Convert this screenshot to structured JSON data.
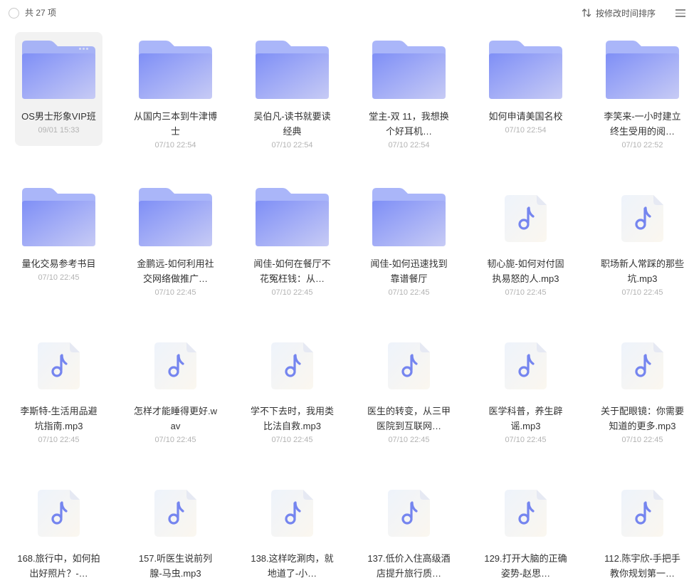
{
  "toolbar": {
    "count_label": "共 27 项",
    "sort_label": "按修改时间排序"
  },
  "colors": {
    "folder_back": "#8e9df7",
    "folder_front_start": "#7f8ff6",
    "folder_front_end": "#c7cbf5",
    "note_icon": "#7585ef",
    "selected_bg": "#f2f2f2"
  },
  "items": [
    {
      "type": "folder",
      "name": "OS男士形象VIP班",
      "date": "09/01 15:33",
      "selected": true
    },
    {
      "type": "folder",
      "name": "从国内三本到牛津博士",
      "date": "07/10 22:54"
    },
    {
      "type": "folder",
      "name": "吴伯凡-读书就要读经典",
      "date": "07/10 22:54"
    },
    {
      "type": "folder",
      "name": "堂主-双 11，我想换个好耳机…",
      "date": "07/10 22:54"
    },
    {
      "type": "folder",
      "name": "如何申请美国名校",
      "date": "07/10 22:54"
    },
    {
      "type": "folder",
      "name": "李笑来-一小时建立终生受用的阅…",
      "date": "07/10 22:52"
    },
    {
      "type": "folder",
      "name": "量化交易参考书目",
      "date": "07/10 22:45"
    },
    {
      "type": "folder",
      "name": "金鹏远-如何利用社交网络做推广…",
      "date": "07/10 22:45"
    },
    {
      "type": "folder",
      "name": "闻佳-如何在餐厅不花冤枉钱：从…",
      "date": "07/10 22:45"
    },
    {
      "type": "folder",
      "name": "闻佳-如何迅速找到靠谱餐厅",
      "date": "07/10 22:45"
    },
    {
      "type": "audio",
      "name": "韧心旎-如何对付固执易怒的人.mp3",
      "date": "07/10 22:45"
    },
    {
      "type": "audio",
      "name": "职场新人常踩的那些坑.mp3",
      "date": "07/10 22:45"
    },
    {
      "type": "audio",
      "name": "李斯特-生活用品避坑指南.mp3",
      "date": "07/10 22:45"
    },
    {
      "type": "audio",
      "name": "怎样才能睡得更好.wav",
      "date": "07/10 22:45"
    },
    {
      "type": "audio",
      "name": "学不下去时，我用类比法自救.mp3",
      "date": "07/10 22:45"
    },
    {
      "type": "audio",
      "name": "医生的转变，从三甲医院到互联网…",
      "date": "07/10 22:45"
    },
    {
      "type": "audio",
      "name": "医学科普，养生辟谣.mp3",
      "date": "07/10 22:45"
    },
    {
      "type": "audio",
      "name": "关于配眼镜：你需要知道的更多.mp3",
      "date": "07/10 22:45"
    },
    {
      "type": "audio",
      "name": "168.旅行中，如何拍出好照片？-…",
      "date": ""
    },
    {
      "type": "audio",
      "name": "157.听医生说前列腺-马虫.mp3",
      "date": ""
    },
    {
      "type": "audio",
      "name": "138.这样吃涮肉，就地道了-小…",
      "date": ""
    },
    {
      "type": "audio",
      "name": "137.低价入住高级酒店提升旅行质…",
      "date": ""
    },
    {
      "type": "audio",
      "name": "129.打开大脑的正确姿势-赵思…",
      "date": ""
    },
    {
      "type": "audio",
      "name": "112.陈宇欣-手把手教你规划第一…",
      "date": ""
    }
  ]
}
